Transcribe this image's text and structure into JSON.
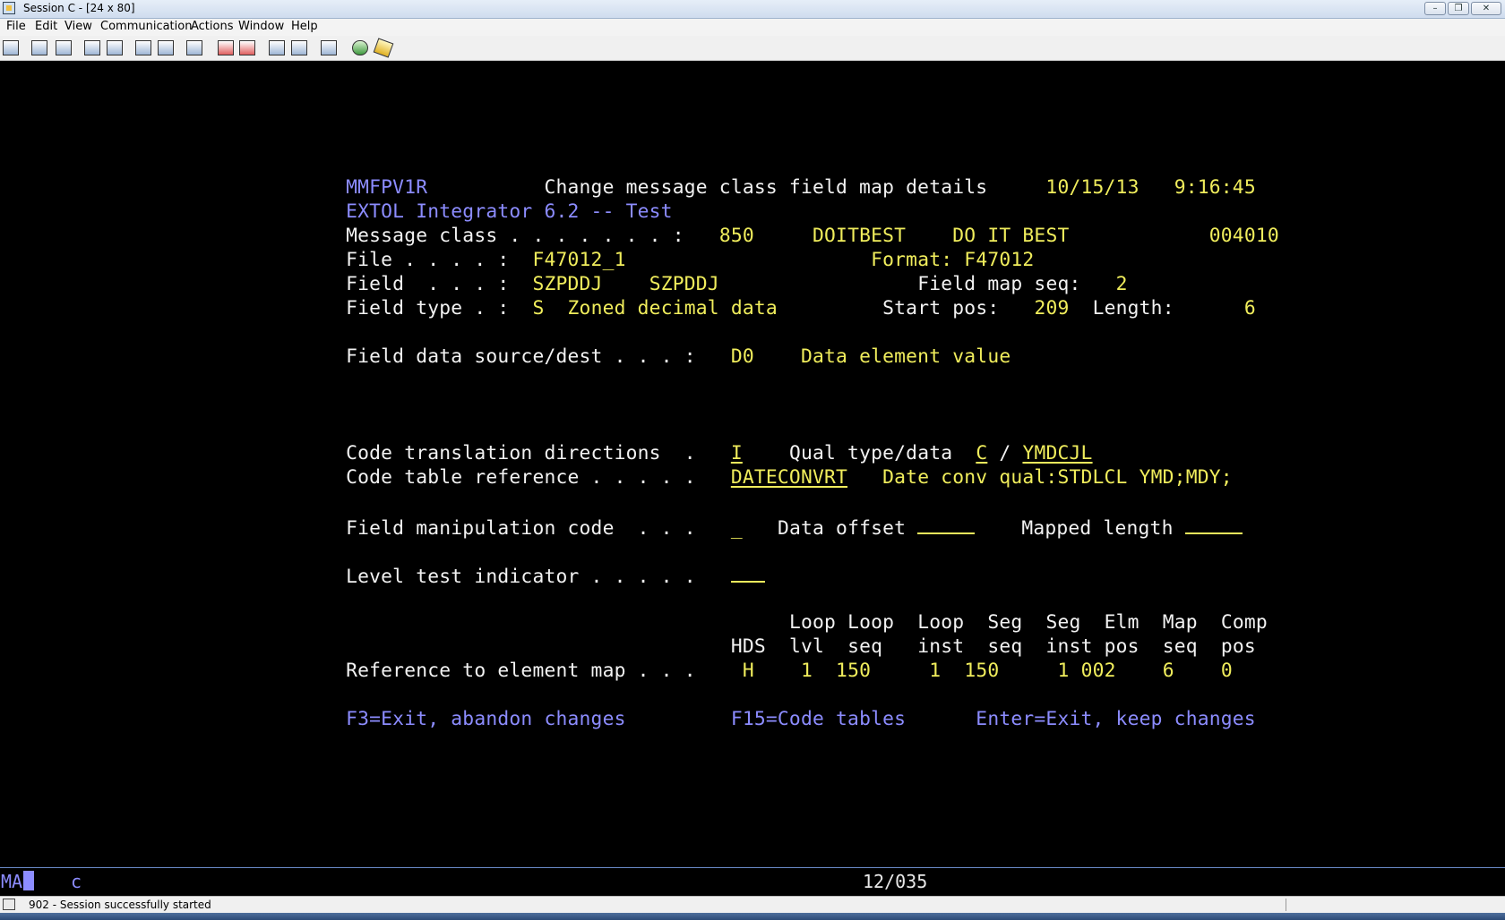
{
  "window": {
    "title": "Session C - [24 x 80]",
    "minimize": "–",
    "maximize": "❐",
    "close": "✕"
  },
  "menu": [
    "File",
    "Edit",
    "View",
    "Communication",
    "Actions",
    "Window",
    "Help"
  ],
  "screen": {
    "program_id": "MMFPV1R",
    "screen_title": "Change message class field map details",
    "date": "10/15/13",
    "time": "9:16:45",
    "subtitle": "EXTOL Integrator 6.2 -- Test",
    "message_class": {
      "label": "Message class . . . . . . . :",
      "value": "850",
      "partner": "DOITBEST",
      "partner_name": "DO IT BEST",
      "version": "004010"
    },
    "file": {
      "label": "File . . . . :",
      "value": "F47012_1",
      "format_label": "Format:",
      "format": "F47012"
    },
    "field": {
      "label": "Field  . . . :",
      "value": "SZPDDJ",
      "value2": "SZPDDJ",
      "seq_label": "Field map seq:",
      "seq": "2"
    },
    "field_type": {
      "label": "Field type . :",
      "code": "S",
      "desc": "Zoned decimal data",
      "start_label": "Start pos:",
      "start": "209",
      "length_label": "Length:",
      "length": "6"
    },
    "source": {
      "label": "Field data source/dest . . . :",
      "code": "D0",
      "desc": "Data element value"
    },
    "code_trans": {
      "label": "Code translation directions  .",
      "value": "I",
      "qual_label": "Qual type/data",
      "qual_type": "C",
      "slash": "/",
      "qual_data": "YMDCJL"
    },
    "code_table": {
      "label": "Code table reference . . . . .",
      "value": "DATECONVRT",
      "desc": "Date conv qual:STDLCL YMD;MDY;"
    },
    "manip": {
      "label": "Field manipulation code  . . .",
      "value": "_",
      "offset_label": "Data offset",
      "mapped_label": "Mapped length"
    },
    "level": {
      "label": "Level test indicator . . . . ."
    },
    "ref": {
      "label": "Reference to element map . . .",
      "headers_top": [
        "Loop",
        "Loop",
        "Loop",
        "Seg",
        "Seg",
        "Elm",
        "Map",
        "Comp"
      ],
      "headers_bottom": [
        "HDS",
        "lvl",
        "seq",
        "inst",
        "seq",
        "inst",
        "pos",
        "seq",
        "pos"
      ],
      "values": [
        "H",
        "1",
        "150",
        "1",
        "150",
        "1",
        "002",
        "6",
        "0"
      ]
    },
    "fkeys": {
      "f3": "F3=Exit, abandon changes",
      "f15": "F15=Code tables",
      "enter": "Enter=Exit, keep changes"
    }
  },
  "oia": {
    "ma": "MA",
    "indicator": "c",
    "cursor_pos": "12/035"
  },
  "status": {
    "text": "902 - Session successfully started"
  }
}
